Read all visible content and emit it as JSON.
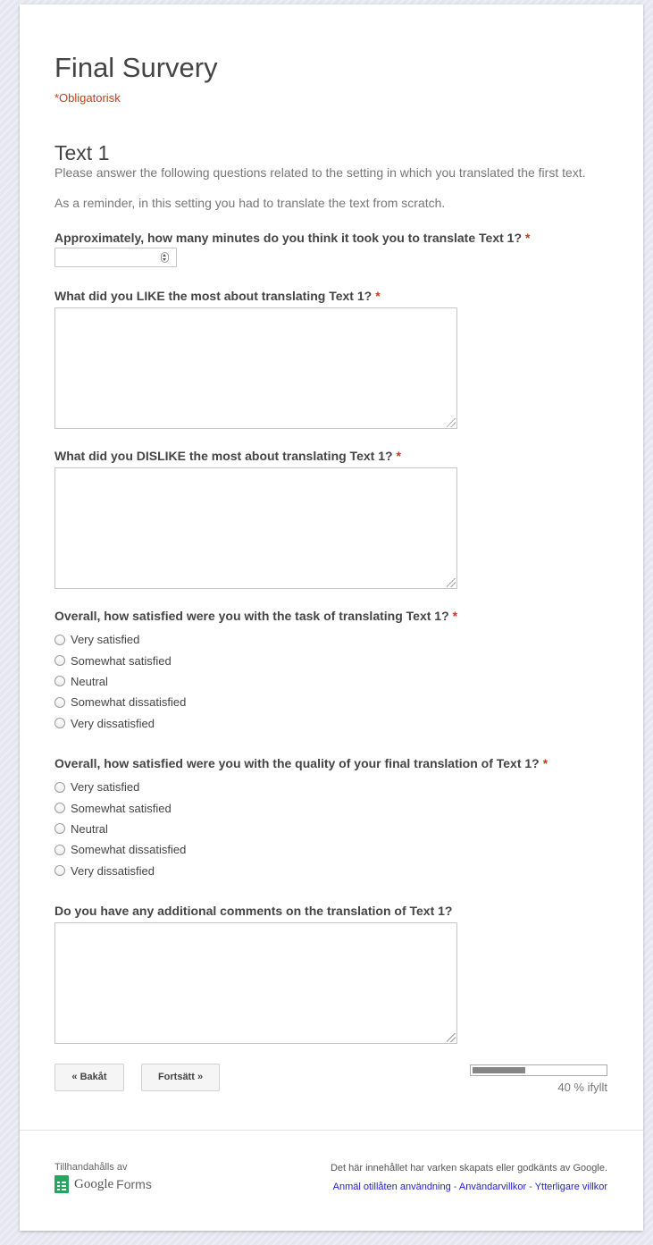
{
  "form": {
    "title": "Final Survery",
    "required_note": "*Obligatorisk"
  },
  "section": {
    "title": "Text 1",
    "description": "Please answer the following questions related to the setting in which you translated the first text.",
    "reminder": "As a reminder, in this setting you had to translate the text from scratch."
  },
  "questions": [
    {
      "title": "Approximately, how many minutes do you think it took you to translate Text 1?",
      "required": "*",
      "value": ""
    },
    {
      "title": "What did you LIKE the most about translating Text 1?",
      "required": "*",
      "value": ""
    },
    {
      "title": "What did you DISLIKE the most about translating Text 1?",
      "required": "*",
      "value": ""
    },
    {
      "title": "Overall, how satisfied were you with the task of translating Text 1?",
      "required": "*",
      "options": [
        "Very satisfied",
        "Somewhat satisfied",
        "Neutral",
        "Somewhat dissatisfied",
        "Very dissatisfied"
      ]
    },
    {
      "title": "Overall, how satisfied were you with the quality of your final translation of Text 1?",
      "required": "*",
      "options": [
        "Very satisfied",
        "Somewhat satisfied",
        "Neutral",
        "Somewhat dissatisfied",
        "Very dissatisfied"
      ]
    },
    {
      "title": "Do you have any additional comments on the translation of Text 1?",
      "value": ""
    }
  ],
  "navigation": {
    "back_label": "« Bakåt",
    "continue_label": "Fortsätt »"
  },
  "progress": {
    "fraction": 0.4,
    "label": "40 % ifyllt"
  },
  "footer": {
    "provided_by": "Tillhandahålls av",
    "logo_google": "Google",
    "logo_forms": "Forms",
    "disclaimer": "Det här innehållet har varken skapats eller godkänts av Google.",
    "link_report": "Anmäl otillåten användning",
    "link_terms": "Användarvillkor",
    "link_additional": "Ytterligare villkor",
    "separator": " - "
  },
  "colors": {
    "accent_required": "#c43b1d",
    "link": "#2222cc",
    "progress_fill": "#858585",
    "logo_green": "#25a55f"
  }
}
